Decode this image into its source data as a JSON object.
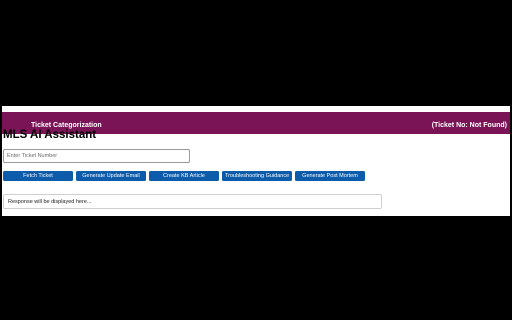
{
  "header": {
    "category_label": "Ticket Categorization",
    "ticket_status": "(Ticket No: Not Found)",
    "color": "#7a1457"
  },
  "page": {
    "title": "MLS AI Assistant"
  },
  "ticket_input": {
    "placeholder": "Enter Ticket Number",
    "value": ""
  },
  "actions": {
    "fetch": "Fetch Ticket",
    "email": "Generate Update Email",
    "kb": "Create KB Article",
    "troubleshoot": "Troubleshooting Guidance",
    "postmortem": "Generate Post Mortem",
    "button_color": "#0d5cac"
  },
  "response": {
    "text": "Response will be displayed here..."
  }
}
